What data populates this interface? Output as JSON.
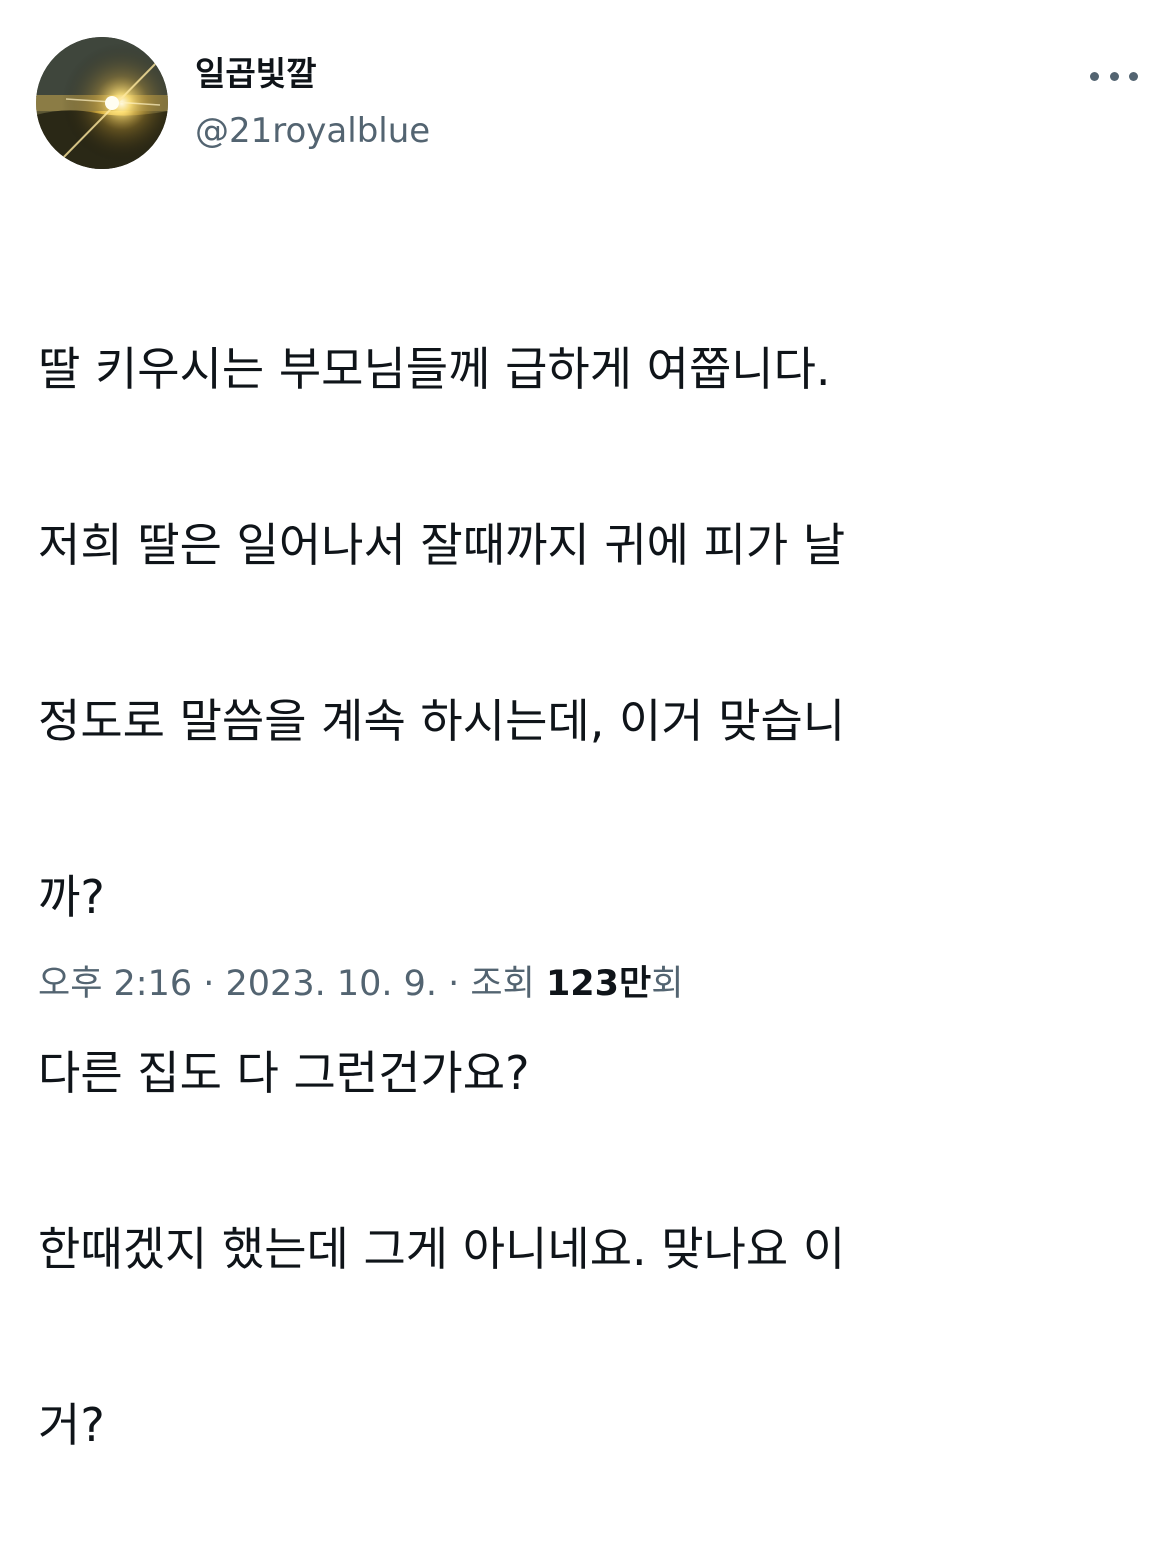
{
  "author": {
    "display_name": "일곱빛깔",
    "handle": "@21royalblue",
    "avatar": "sunrise-landscape-avatar"
  },
  "menu": {
    "icon": "more-horizontal-icon"
  },
  "tweet": {
    "lines": [
      "딸 키우시는 부모님들께 급하게 여쭙니다.",
      "저희 딸은 일어나서 잘때까지 귀에 피가 날",
      "정도로 말씀을 계속 하시는데, 이거 맞습니",
      "까?",
      "다른 집도 다 그런건가요?",
      "한때겠지 했는데 그게 아니네요. 맞나요 이",
      "거?"
    ]
  },
  "meta": {
    "time": "오후 2:16",
    "sep1": " · ",
    "date": "2023. 10. 9.",
    "sep2": " · ",
    "views_label": "조회 ",
    "views_count": "123만",
    "views_suffix": "회"
  },
  "colors": {
    "text": "#0f1419",
    "secondary": "#536471",
    "background": "#ffffff"
  }
}
